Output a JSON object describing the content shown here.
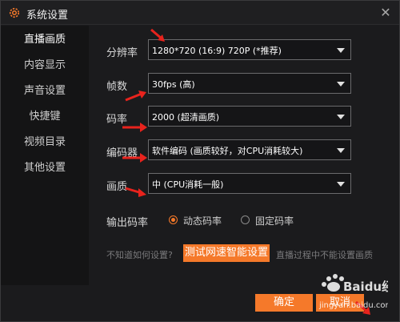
{
  "window": {
    "title": "系统设置",
    "close_glyph": "✕"
  },
  "sidebar": {
    "items": [
      {
        "label": "直播画质"
      },
      {
        "label": "内容显示"
      },
      {
        "label": "声音设置"
      },
      {
        "label": "快捷键"
      },
      {
        "label": "视频目录"
      },
      {
        "label": "其他设置"
      }
    ],
    "active_index": 0
  },
  "settings": {
    "resolution": {
      "label": "分辨率",
      "value": "1280*720 (16:9) 720P (*推荐)"
    },
    "fps": {
      "label": "帧数",
      "value": "30fps (高)"
    },
    "bitrate": {
      "label": "码率",
      "value": "2000 (超清画质)"
    },
    "encoder": {
      "label": "编码器",
      "value": "软件编码 (画质较好，对CPU消耗较大)"
    },
    "quality": {
      "label": "画质",
      "value": "中 (CPU消耗一般)"
    }
  },
  "output_bitrate": {
    "label": "输出码率",
    "options": [
      {
        "label": "动态码率",
        "selected": true
      },
      {
        "label": "固定码率",
        "selected": false
      }
    ]
  },
  "hints": {
    "how_to": "不知道如何设置?",
    "speed_test_button": "测试网速智能设置",
    "live_note": "直播过程中不能设置画质"
  },
  "footer": {
    "ok_label": "确定",
    "cancel_label": "取消"
  },
  "watermark": {
    "brand": "Baidu经验",
    "url": "jingyan.baidu.com"
  },
  "colors": {
    "accent": "#f5792a",
    "annotation_arrow": "#e8231d",
    "background": "#1b1b1d",
    "sidebar": "#141415"
  },
  "icons": {
    "title_icon": "gear-icon",
    "close": "close-icon",
    "dropdown": "chevron-down-icon"
  }
}
